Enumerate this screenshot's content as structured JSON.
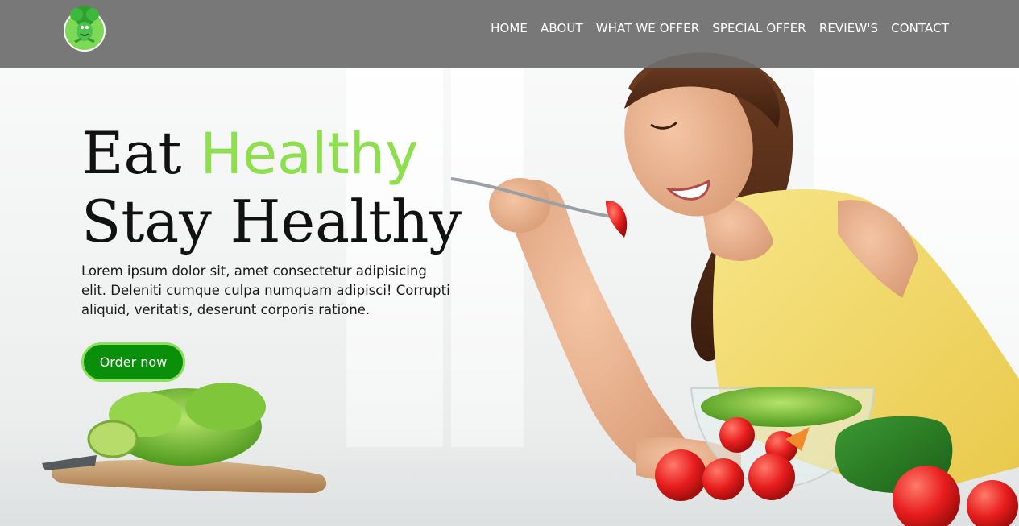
{
  "nav": {
    "items": [
      {
        "label": "HOME"
      },
      {
        "label": "ABOUT"
      },
      {
        "label": "WHAT WE OFFER"
      },
      {
        "label": "SPECIAL OFFER"
      },
      {
        "label": "REVIEW'S"
      },
      {
        "label": "CONTACT"
      }
    ]
  },
  "hero": {
    "headline_before": "Eat ",
    "headline_accent": "Healthy",
    "headline_after": " Stay Healthy",
    "intro": "Lorem ipsum dolor sit, amet consectetur adipisicing elit. Deleniti cumque culpa numquam adipisci! Corrupti aliquid, veritatis, deserunt corporis ratione.",
    "cta_label": "Order now"
  },
  "colors": {
    "navbar": "#6e6e6e",
    "accent_green": "#8ddf4d",
    "button_green": "#0a8f0a",
    "button_border": "#8ee05c"
  },
  "icons": {
    "logo": "broccoli-mascot-logo"
  }
}
